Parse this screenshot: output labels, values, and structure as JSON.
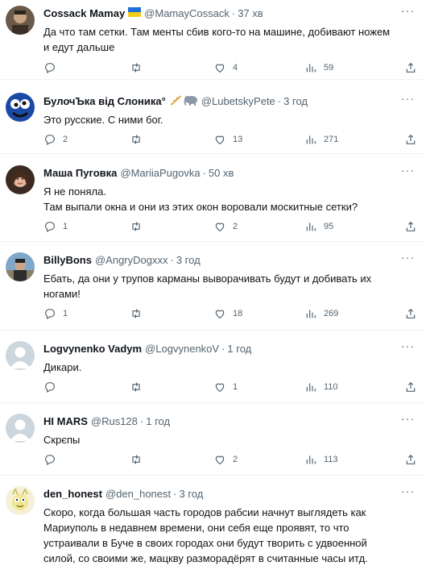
{
  "tweets": [
    {
      "name": "Cossack Mamay",
      "flag": true,
      "handle": "@MamayCossack",
      "time": "37 хв",
      "text": [
        "Да что там сетки. Там менты сбив кого-то на машине, добивают ножем",
        "и едут дальше"
      ],
      "replies": "",
      "retweets": "",
      "likes": "4",
      "views": "59"
    },
    {
      "name": "БулочЪка від Слоника°",
      "decor": true,
      "handle": "@LubetskyPete",
      "time": "3 год",
      "text": [
        "Это русские. С ними бог."
      ],
      "replies": "2",
      "retweets": "",
      "likes": "13",
      "views": "271"
    },
    {
      "name": "Маша Пуговка",
      "handle": "@MariiaPugovka",
      "time": "50 хв",
      "text": [
        "Я не поняла.",
        "Там выпали окна и они из этих окон воровали москитные сетки?"
      ],
      "replies": "1",
      "retweets": "",
      "likes": "2",
      "views": "95"
    },
    {
      "name": "BillyBons",
      "handle": "@AngryDogxxx",
      "time": "3 год",
      "text": [
        "Ебать, да они у трупов карманы выворачивать будут и добивать их",
        "ногами!"
      ],
      "replies": "1",
      "retweets": "",
      "likes": "18",
      "views": "269"
    },
    {
      "name": "Logvynenko Vadym",
      "handle": "@LogvynenkoV",
      "time": "1 год",
      "text": [
        "Дикари."
      ],
      "replies": "",
      "retweets": "",
      "likes": "1",
      "views": "110"
    },
    {
      "name": "HI MARS",
      "handle": "@Rus128",
      "time": "1 год",
      "text": [
        "Скрєпы"
      ],
      "replies": "",
      "retweets": "",
      "likes": "2",
      "views": "113"
    },
    {
      "name": "den_honest",
      "handle": "@den_honest",
      "time": "3 год",
      "text": [
        "Скоро, когда большая часть городов рабсии начнут выглядеть как",
        "Мариуполь в недавнем времени, они себя еще проявят, то что",
        "устраивали в Буче в своих городах они будут творить с удвоенной",
        "силой, со своими же, мацкву разморадёрят в считанные часы итд."
      ],
      "replies": "",
      "retweets": "",
      "likes": "",
      "views": ""
    }
  ],
  "icons": {
    "reply": "reply-icon",
    "retweet": "retweet-icon",
    "like": "heart-icon",
    "views": "views-icon",
    "share": "share-icon",
    "more": "more-icon"
  },
  "colors": {
    "text": "#0f1419",
    "muted": "#536471",
    "divider": "#eff3f4"
  }
}
